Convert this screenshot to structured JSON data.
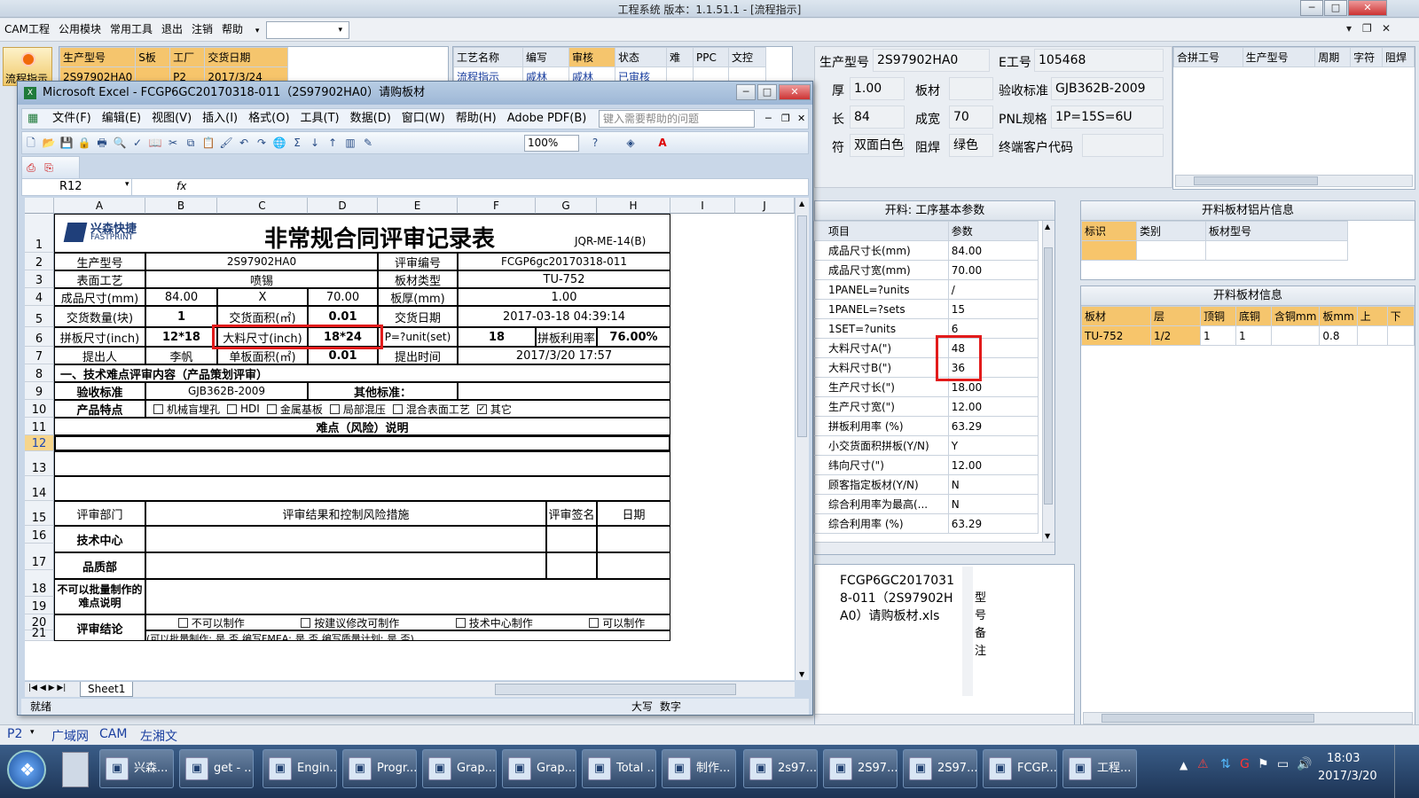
{
  "app_title": "工程系统 版本：1.1.51.1 - [流程指示]",
  "menu": [
    "CAM工程",
    "公用模块",
    "常用工具",
    "退出",
    "注销",
    "帮助"
  ],
  "left_button": "流程指示",
  "top_left_grid": {
    "headers": [
      "生产型号",
      "S板",
      "工厂",
      "交货日期"
    ],
    "row": [
      "2S97902HA0",
      "",
      "P2",
      "2017/3/24"
    ]
  },
  "top_mid_grid": {
    "headers": [
      "工艺名称",
      "编写",
      "审核",
      "状态",
      "难",
      "PPC",
      "文控"
    ],
    "row": [
      "流程指示",
      "戚林",
      "戚林",
      "已审核",
      "",
      "",
      ""
    ]
  },
  "info": {
    "prod_model_label": "生产型号",
    "prod_model": "2S97902HA0",
    "e_no_label": "E工号",
    "e_no": "105468",
    "thick_label": "厚",
    "thick": "1.00",
    "board_label": "板材",
    "board": "",
    "accept_label": "验收标准",
    "accept": "GJB362B-2009",
    "length_label": "长",
    "length": "84",
    "width_label": "成宽",
    "width": "70",
    "pnl_label": "PNL规格",
    "pnl": "1P=15S=6U",
    "silk_label": "符",
    "silk": "双面白色",
    "mask_label": "阻焊",
    "mask": "绿色",
    "client_label": "终端客户代码",
    "client": ""
  },
  "merge_grid": {
    "headers": [
      "合拼工号",
      "生产型号",
      "周期",
      "字符",
      "阻焊"
    ]
  },
  "params_panel": {
    "title": "开料: 工序基本参数",
    "headers": [
      "项目",
      "参数"
    ],
    "rows": [
      [
        "成品尺寸长(mm)",
        "84.00"
      ],
      [
        "成品尺寸宽(mm)",
        "70.00"
      ],
      [
        "1PANEL=?units",
        "/"
      ],
      [
        "1PANEL=?sets",
        "15"
      ],
      [
        "1SET=?units",
        "6"
      ],
      [
        "大料尺寸A(\")",
        "48"
      ],
      [
        "大料尺寸B(\")",
        "36"
      ],
      [
        "生产尺寸长(\")",
        "18.00"
      ],
      [
        "生产尺寸宽(\")",
        "12.00"
      ],
      [
        "拼板利用率 (%)",
        "63.29"
      ],
      [
        "小交货面积拼板(Y/N)",
        "Y"
      ],
      [
        "纬向尺寸(\")",
        "12.00"
      ],
      [
        "顾客指定板材(Y/N)",
        "N"
      ],
      [
        "综合利用率为最高(...",
        "N"
      ],
      [
        "综合利用率 (%)",
        "63.29"
      ]
    ]
  },
  "alu_panel": {
    "title": "开料板材铝片信息",
    "headers": [
      "标识",
      "类别",
      "板材型号"
    ]
  },
  "board_panel": {
    "title": "开料板材信息",
    "headers": [
      "板材",
      "层",
      "顶铜",
      "底铜",
      "含铜mm",
      "板mm",
      "上",
      "下"
    ],
    "row": [
      "TU-752",
      "1/2",
      "1",
      "1",
      "",
      "0.8",
      "",
      ""
    ]
  },
  "note_panel": {
    "text": "FCGP6GC20170318-011（2S97902HA0）请购板材.xls",
    "side": "型号备注"
  },
  "excel": {
    "title": "Microsoft Excel - FCGP6GC20170318-011（2S97902HA0）请购板材",
    "menu": [
      "文件(F)",
      "编辑(E)",
      "视图(V)",
      "插入(I)",
      "格式(O)",
      "工具(T)",
      "数据(D)",
      "窗口(W)",
      "帮助(H)",
      "Adobe PDF(B)"
    ],
    "help_placeholder": "键入需要帮助的问题",
    "zoom": "100%",
    "name_box": "R12",
    "fx": "fx",
    "cols": [
      "A",
      "B",
      "C",
      "D",
      "E",
      "F",
      "G",
      "H",
      "I",
      "J"
    ],
    "rows": [
      "1",
      "2",
      "3",
      "4",
      "5",
      "6",
      "7",
      "8",
      "9",
      "10",
      "11",
      "12",
      "13",
      "14",
      "15",
      "16",
      "17",
      "18",
      "19",
      "20",
      "21"
    ],
    "logo_cn": "兴森快捷",
    "logo_en": "FASTPRINT",
    "doc_title": "非常规合同评审记录表",
    "doc_code": "JQR-ME-14(B)",
    "r2": [
      "生产型号",
      "2S97902HA0",
      "评审编号",
      "FCGP6gc20170318-011"
    ],
    "r3": [
      "表面工艺",
      "喷锡",
      "板材类型",
      "TU-752"
    ],
    "r4": [
      "成品尺寸(mm)",
      "84.00",
      "X",
      "70.00",
      "板厚(mm)",
      "1.00"
    ],
    "r5": [
      "交货数量(块)",
      "1",
      "交货面积(㎡)",
      "0.01",
      "交货日期",
      "2017-03-18 04:39:14"
    ],
    "r6": [
      "拼板尺寸(inch)",
      "12*18",
      "大料尺寸(inch)",
      "18*24",
      "P=?unit(set)",
      "18",
      "拼板利用率",
      "76.00%"
    ],
    "r7": [
      "提出人",
      "李帆",
      "单板面积(㎡)",
      "0.01",
      "提出时间",
      "2017/3/20 17:57"
    ],
    "r8": "一、技术难点评审内容（产品策划评审）",
    "r9": [
      "验收标准",
      "GJB362B-2009",
      "其他标准："
    ],
    "r10_label": "产品特点",
    "r10_opts": [
      "机械盲埋孔",
      "HDI",
      "金属基板",
      "局部混压",
      "混合表面工艺",
      "其它"
    ],
    "r11": "难点（风险）说明",
    "r15": [
      "评审部门",
      "评审结果和控制风险措施",
      "评审签名",
      "日期"
    ],
    "r16": "技术中心",
    "r17": "品质部",
    "r18": "不可以批量制作的难点说明",
    "r20_label": "评审结论",
    "r20_opts": [
      "不可以制作",
      "按建议修改可制作",
      "技术中心制作",
      "可以制作"
    ],
    "r21": [
      "(可以批量制作:",
      "是",
      "否",
      "编写FMEA:",
      "是",
      "否",
      "编写质量计划:",
      "是",
      "否)"
    ],
    "sheet_tab": "Sheet1",
    "status": "就绪",
    "caps": "大写",
    "num": "数字"
  },
  "bottom_status": [
    "P2",
    "广域网",
    "CAM",
    "左湘文"
  ],
  "taskbar": {
    "items": [
      "兴森...",
      "get - ...",
      "Engin...",
      "Progr...",
      "Grap...",
      "Grap...",
      "Total ...",
      "制作...",
      "2s97...",
      "2S97...",
      "2S97...",
      "FCGP...",
      "工程..."
    ],
    "time": "18:03",
    "date": "2017/3/20"
  }
}
